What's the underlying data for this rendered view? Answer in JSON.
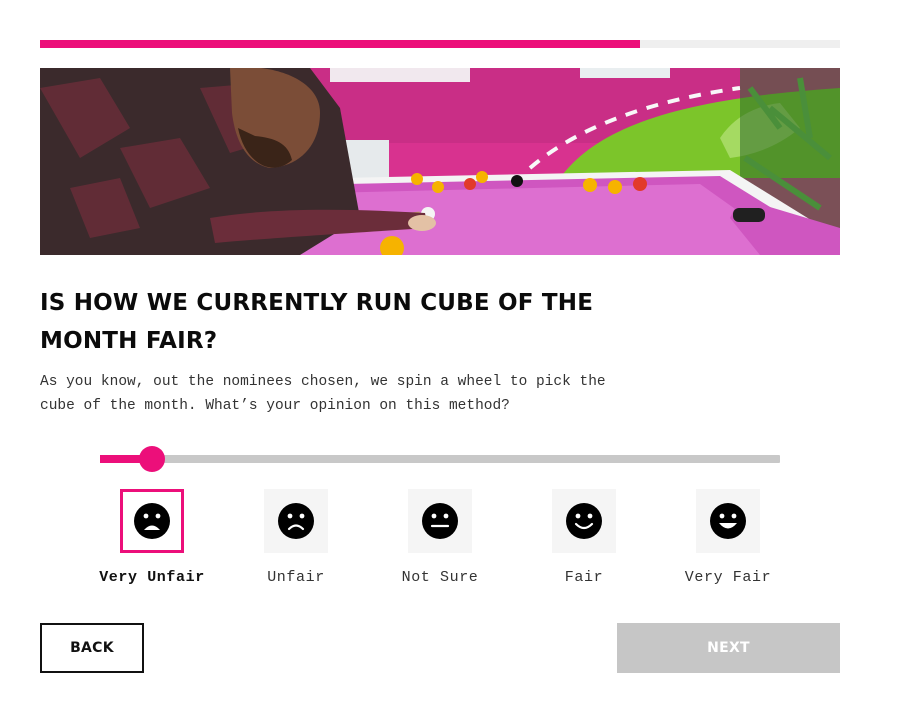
{
  "progress": {
    "fraction": 0.75
  },
  "hero_image": {
    "icon": "pool-table-photo"
  },
  "question": {
    "title": "IS HOW WE CURRENTLY RUN CUBE OF THE MONTH FAIR?",
    "description": "As you know, out the nominees chosen, we spin a wheel to pick the cube of the month. What’s your opinion on this method?"
  },
  "rating": {
    "selected_index": 0,
    "scale_max_index": 4,
    "options": [
      {
        "label": "Very Unfair",
        "icon": "very-unfair-face-icon"
      },
      {
        "label": "Unfair",
        "icon": "unfair-face-icon"
      },
      {
        "label": "Not Sure",
        "icon": "neutral-face-icon"
      },
      {
        "label": "Fair",
        "icon": "fair-face-icon"
      },
      {
        "label": "Very Fair",
        "icon": "very-fair-face-icon"
      }
    ]
  },
  "buttons": {
    "back": "BACK",
    "next": "NEXT"
  },
  "colors": {
    "accent": "#ec0f7a",
    "disabled": "#c6c6c6",
    "track": "#c8c8c8"
  }
}
